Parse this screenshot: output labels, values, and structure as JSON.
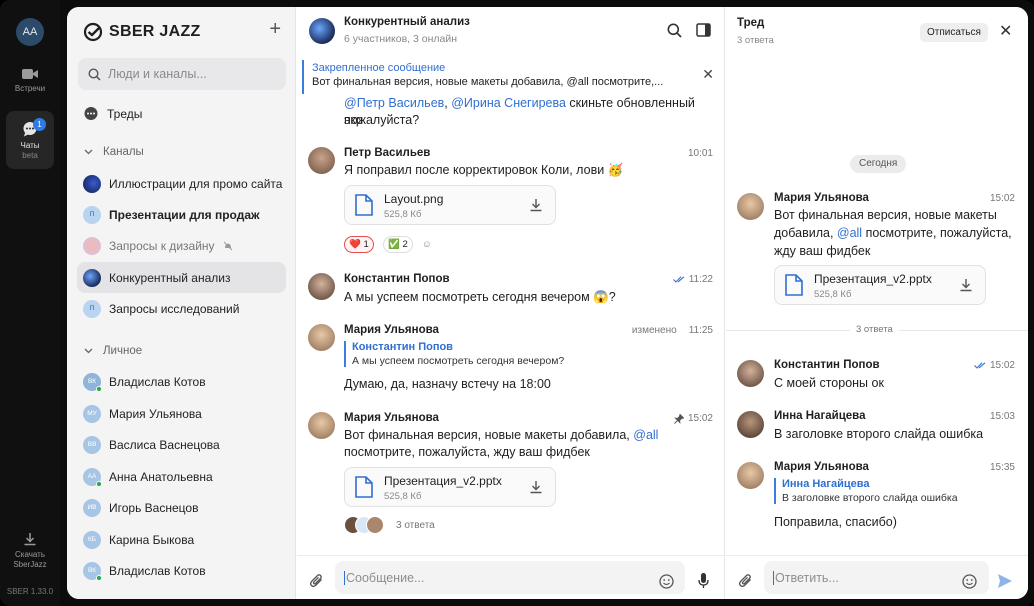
{
  "rail": {
    "avatar": "AA",
    "meetings": "Встречи",
    "chats": "Чаты",
    "chats_sub": "beta",
    "chats_badge": "1",
    "download": "Скачать SberJazz",
    "version": "SBER 1.33.0"
  },
  "sidebar": {
    "brand": "SBER JAZZ",
    "search_placeholder": "Люди и каналы...",
    "threads": "Треды",
    "channels_title": "Каналы",
    "channels": [
      {
        "label": "Иллюстрации для промо сайта",
        "initials": ""
      },
      {
        "label": "Презентации для продаж",
        "initials": "П"
      },
      {
        "label": "Запросы к дизайну",
        "initials": ""
      },
      {
        "label": "Конкурентный анализ",
        "initials": ""
      },
      {
        "label": "Запросы исследований",
        "initials": "П"
      }
    ],
    "personal_title": "Личное",
    "personal": [
      {
        "label": "Владислав Котов",
        "initials": "ВК"
      },
      {
        "label": "Мария Ульянова",
        "initials": "МУ"
      },
      {
        "label": "Васлиса Васнецова",
        "initials": "ВВ"
      },
      {
        "label": "Анна Анатольевна",
        "initials": "АА"
      },
      {
        "label": "Игорь Васнецов",
        "initials": "ИВ"
      },
      {
        "label": "Карина Быкова",
        "initials": "КБ"
      },
      {
        "label": "Владислав Котов",
        "initials": "ВК"
      }
    ]
  },
  "chat": {
    "title": "Конкурентный анализ",
    "subtitle": "6 участников, 3 онлайн",
    "pinned_title": "Закрепленное сообщение",
    "pinned_text": "Вот финальная версия, новые макеты добавила, @all посмотрите,...",
    "scrolled_line1_a": "@Петр Васильев",
    "scrolled_line1_sep": ", ",
    "scrolled_line1_b": "@Ирина Снегирева",
    "scrolled_line1_c": " скиньте обновленный экр",
    "scrolled_line2": "пожалуйста?",
    "messages": [
      {
        "name": "Петр Васильев",
        "time": "10:01",
        "text": "Я поправил после корректировок Коли, лови 🥳",
        "file": {
          "name": "Layout.png",
          "size": "525,8 Кб"
        },
        "reactions": [
          "❤️ 1",
          "✅ 2"
        ]
      },
      {
        "name": "Константин Попов",
        "time": "11:22",
        "text": "А мы успеем посмотреть сегодня вечером 😱?"
      },
      {
        "name": "Мария Ульянова",
        "edited": "изменено",
        "time": "11:25",
        "reply_name": "Константин Попов",
        "reply_text": "А мы успеем посмотреть сегодня вечером?",
        "text": "Думаю, да, назначу встечу на 18:00"
      },
      {
        "name": "Мария Ульянова",
        "time": "15:02",
        "text_a": "Вот финальная версия, новые макеты добавила, ",
        "mention": "@all",
        "text_b": "посмотрите, пожалуйста, жду ваш фидбек",
        "file": {
          "name": "Презентация_v2.pptx",
          "size": "525,8 Кб"
        },
        "replies": "3 ответа"
      }
    ],
    "input_placeholder": "Сообщение..."
  },
  "thread": {
    "title": "Тред",
    "subtitle": "3 ответа",
    "unsubscribe": "Отписаться",
    "day": "Сегодня",
    "root": {
      "name": "Мария Ульянова",
      "time": "15:02",
      "text_a": "Вот финальная версия, новые макеты добавила, ",
      "mention": "@all",
      "text_b": " посмотрите, пожалуйста, жду ваш фидбек",
      "file": {
        "name": "Презентация_v2.pptx",
        "size": "525,8 Кб"
      }
    },
    "separator": "3 ответа",
    "replies": [
      {
        "name": "Константин Попов",
        "time": "15:02",
        "text": "С моей стороны ок"
      },
      {
        "name": "Инна Нагайцева",
        "time": "15:03",
        "text": "В заголовке второго слайда ошибка"
      },
      {
        "name": "Мария Ульянова",
        "time": "15:35",
        "reply_name": "Инна Нагайцева",
        "reply_text": "В заголовке второго слайда ошибка",
        "text": "Поправила, спасибо)"
      }
    ],
    "input_placeholder": "Ответить..."
  },
  "colors": {
    "accent": "#2f6fd1",
    "online": "#22a94b",
    "badge": "#2d7ae8"
  }
}
